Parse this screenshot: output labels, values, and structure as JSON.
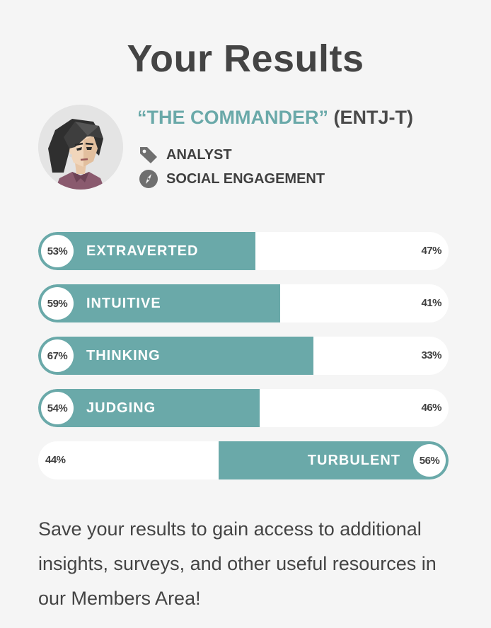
{
  "page": {
    "title": "Your Results"
  },
  "profile": {
    "avatar_icon": "commander-avatar",
    "type_name": "“THE COMMANDER”",
    "type_code": "(ENTJ-T)",
    "role": {
      "icon": "tag-icon",
      "label": "ANALYST"
    },
    "strategy": {
      "icon": "compass-icon",
      "label": "SOCIAL ENGAGEMENT"
    }
  },
  "traits": [
    {
      "trait": "EXTRAVERTED",
      "percent": "53%",
      "opposite_percent": "47%",
      "value": 53,
      "side": "left"
    },
    {
      "trait": "INTUITIVE",
      "percent": "59%",
      "opposite_percent": "41%",
      "value": 59,
      "side": "left"
    },
    {
      "trait": "THINKING",
      "percent": "67%",
      "opposite_percent": "33%",
      "value": 67,
      "side": "left"
    },
    {
      "trait": "JUDGING",
      "percent": "54%",
      "opposite_percent": "46%",
      "value": 54,
      "side": "left"
    },
    {
      "trait": "TURBULENT",
      "percent": "56%",
      "opposite_percent": "44%",
      "value": 56,
      "side": "right"
    }
  ],
  "cta": {
    "text": "Save your results to gain access to additional insights, surveys, and other useful resources in our Members Area!"
  },
  "colors": {
    "accent": "#6aa9a9",
    "background": "#f5f5f5",
    "track": "#ffffff",
    "text": "#4a4a4a"
  }
}
